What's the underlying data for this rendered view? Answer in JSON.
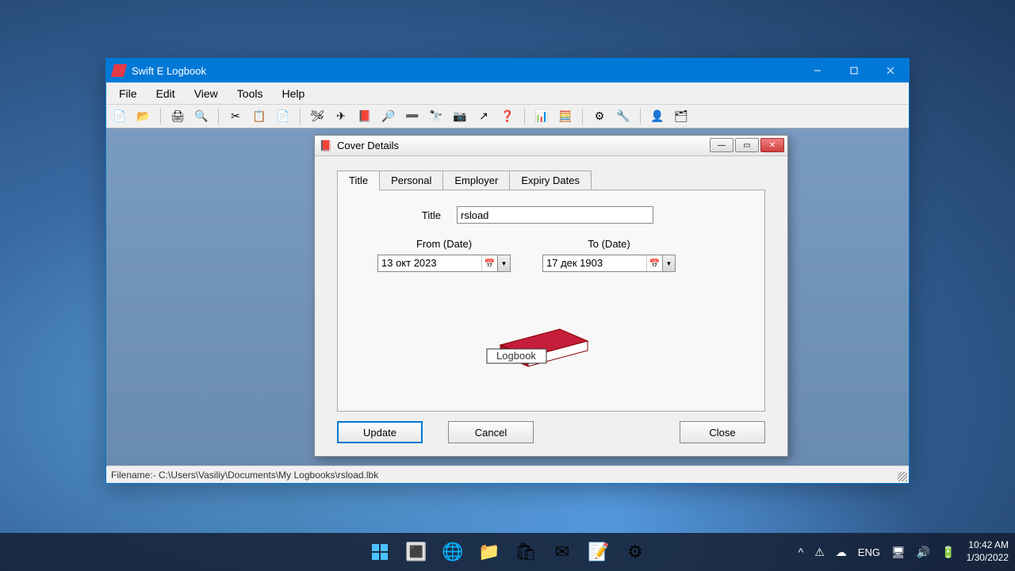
{
  "main_window": {
    "title": "Swift E Logbook",
    "menu": {
      "file": "File",
      "edit": "Edit",
      "view": "View",
      "tools": "Tools",
      "help": "Help"
    },
    "statusbar": "Filename:- C:\\Users\\Vasiliy\\Documents\\My Logbooks\\rsload.lbk"
  },
  "dialog": {
    "title": "Cover Details",
    "tabs": {
      "title": "Title",
      "personal": "Personal",
      "employer": "Employer",
      "expiry": "Expiry Dates"
    },
    "fields": {
      "title_label": "Title",
      "title_value": "rsload",
      "from_label": "From (Date)",
      "from_value": "13 окт 2023",
      "to_label": "To (Date)",
      "to_value": "17 дек 1903"
    },
    "logbook_caption": "Logbook",
    "buttons": {
      "update": "Update",
      "cancel": "Cancel",
      "close": "Close"
    }
  },
  "taskbar": {
    "lang": "ENG",
    "time": "10:42 AM",
    "date": "1/30/2022"
  }
}
